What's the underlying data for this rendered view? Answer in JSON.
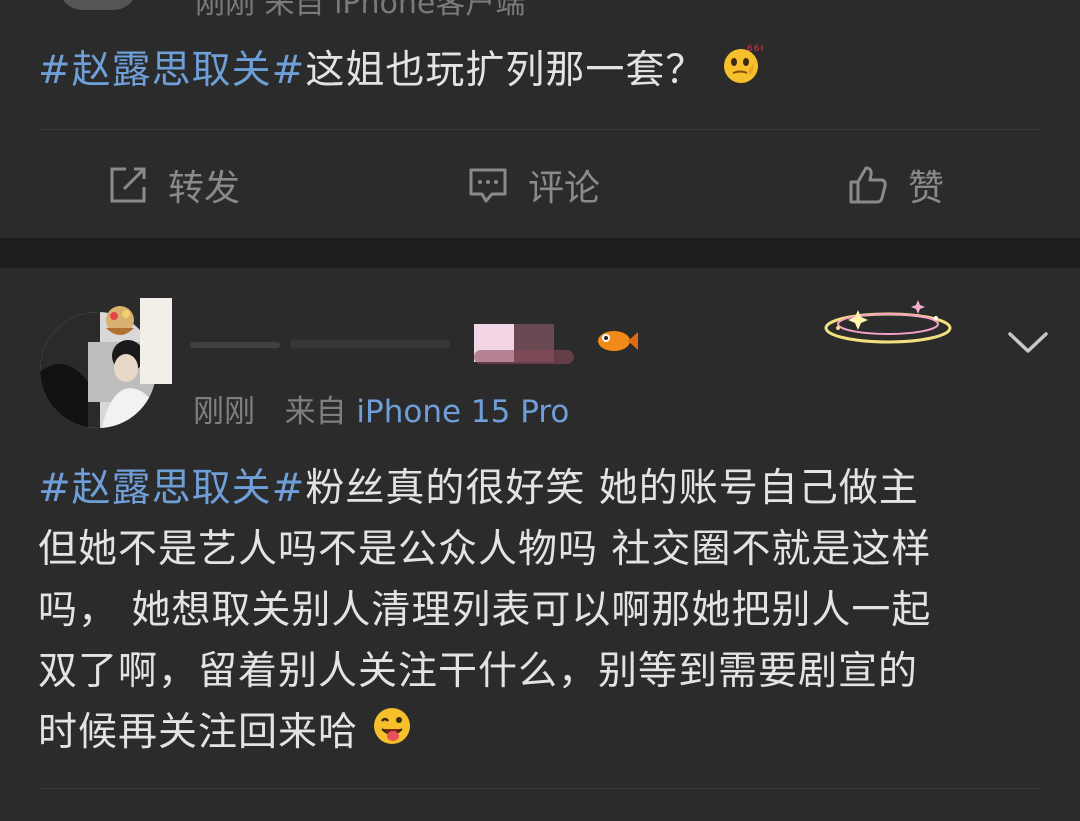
{
  "post1": {
    "meta_text": "刚刚  来自 iPhone客户端",
    "topic": "#赵露思取关#",
    "body": "这姐也玩扩列那一套？",
    "emoji": "thinking-666-emoji"
  },
  "actions": {
    "repost_label": "转发",
    "comment_label": "评论",
    "like_label": "赞"
  },
  "post2": {
    "time": "刚刚",
    "source_prefix": "来自",
    "source_device": "iPhone 15 Pro",
    "topic": "#赵露思取关#",
    "lines": [
      "粉丝真的很好笑 她的账号自己做主",
      "但她不是艺人吗不是公众人物吗 社交圈不就是这样",
      "吗， 她想取关别人清理列表可以啊那她把别人一起",
      "双了啊，留着别人关注干什么，别等到需要剧宣的",
      "时候再关注回来哈"
    ],
    "emoji": "tongue-out-emoji"
  },
  "colors": {
    "topic": "#6f9fd8",
    "background": "#2b2b2b",
    "separator": "#1e1e1e"
  }
}
